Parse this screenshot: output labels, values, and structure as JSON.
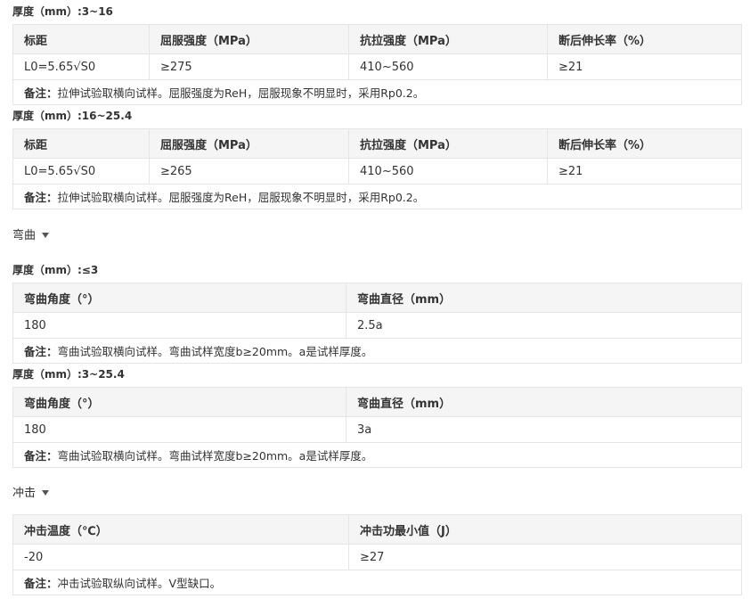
{
  "tensile": {
    "blocks": [
      {
        "thickness_label": "厚度（mm）:3~16",
        "headers": [
          "标距",
          "屈服强度（MPa）",
          "抗拉强度（MPa）",
          "断后伸长率（%）"
        ],
        "row": [
          "L0=5.65√S0",
          "≥275",
          "410~560",
          "≥21"
        ],
        "note_label": "备注：",
        "note_text": "拉伸试验取横向试样。屈服强度为ReH，屈服现象不明显时，采用Rp0.2。"
      },
      {
        "thickness_label": "厚度（mm）:16~25.4",
        "headers": [
          "标距",
          "屈服强度（MPa）",
          "抗拉强度（MPa）",
          "断后伸长率（%）"
        ],
        "row": [
          "L0=5.65√S0",
          "≥265",
          "410~560",
          "≥21"
        ],
        "note_label": "备注：",
        "note_text": "拉伸试验取横向试样。屈服强度为ReH，屈服现象不明显时，采用Rp0.2。"
      }
    ]
  },
  "bend": {
    "section_title": "弯曲",
    "blocks": [
      {
        "thickness_label": "厚度（mm）:≤3",
        "headers": [
          "弯曲角度（°）",
          "弯曲直径（mm）"
        ],
        "row": [
          "180",
          "2.5a"
        ],
        "note_label": "备注：",
        "note_text": "弯曲试验取横向试样。弯曲试样宽度b≥20mm。a是试样厚度。"
      },
      {
        "thickness_label": "厚度（mm）:3~25.4",
        "headers": [
          "弯曲角度（°）",
          "弯曲直径（mm）"
        ],
        "row": [
          "180",
          "3a"
        ],
        "note_label": "备注：",
        "note_text": "弯曲试验取横向试样。弯曲试样宽度b≥20mm。a是试样厚度。"
      }
    ]
  },
  "impact": {
    "section_title": "冲击",
    "headers": [
      "冲击温度（℃）",
      "冲击功最小值（J）"
    ],
    "row": [
      "-20",
      "≥27"
    ],
    "note_label": "备注：",
    "note_text": "冲击试验取纵向试样。V型缺口。"
  }
}
